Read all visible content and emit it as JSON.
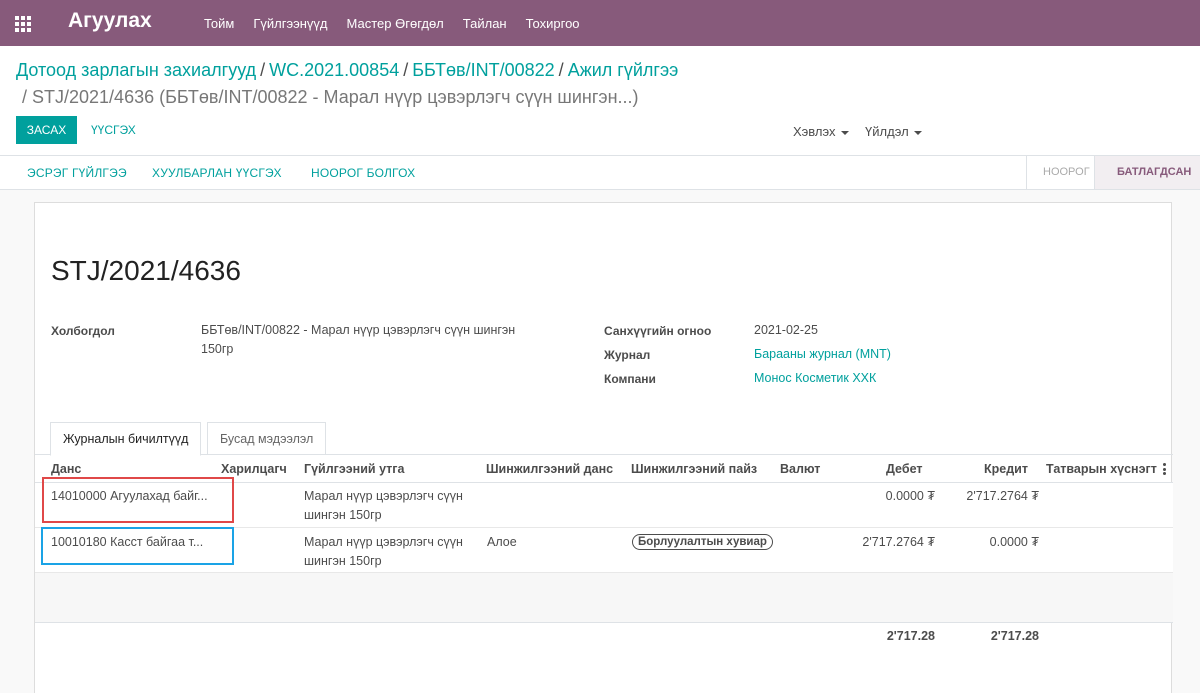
{
  "navbar": {
    "brand": "Агуулах",
    "menu": [
      "Тойм",
      "Гүйлгээнүүд",
      "Мастер Өгөгдөл",
      "Тайлан",
      "Тохиргоо"
    ]
  },
  "breadcrumb": {
    "items": [
      "Дотоод зарлагын захиалгууд",
      "WC.2021.00854",
      "ББТөв/INT/00822",
      "Ажил гүйлгээ"
    ],
    "current": "STJ/2021/4636 (ББТөв/INT/00822 - Марал нүүр цэвэрлэгч сүүн шингэн...)"
  },
  "buttons": {
    "edit": "ЗАСАХ",
    "create": "ҮҮСГЭХ"
  },
  "dropdowns": {
    "print": "Хэвлэх",
    "action": "Үйлдэл"
  },
  "statusbar": {
    "buttons": [
      "ЭСРЭГ ГҮЙЛГЭЭ",
      "ХУУЛБАРЛАН ҮҮСГЭХ",
      "НООРОГ БОЛГОХ"
    ],
    "stages": {
      "draft": "НООРОГ",
      "done": "БАТЛАГДСАН"
    }
  },
  "record": {
    "title": "STJ/2021/4636",
    "reference_label": "Холбогдол",
    "reference_value": "ББТөв/INT/00822 - Марал нүүр цэвэрлэгч сүүн шингэн 150гр",
    "date_label": "Санхүүгийн огноо",
    "date_value": "2021-02-25",
    "journal_label": "Журнал",
    "journal_value": "Барааны журнал (MNT)",
    "company_label": "Компани",
    "company_value": "Монос Косметик ХХК"
  },
  "tabs": {
    "active": "Журналын бичилтүүд",
    "other": "Бусад мэдээлэл"
  },
  "table": {
    "headers": [
      "Данс",
      "Харилцагч",
      "Гүйлгээний утга",
      "Шинжилгээний данс",
      "Шинжилгээний пайз",
      "Валют",
      "Дебет",
      "Кредит",
      "Татварын хүснэгт"
    ],
    "rows": [
      {
        "account": "14010000 Агуулахад байг...",
        "partner": "",
        "label": "Марал нүүр цэвэрлэгч сүүн шингэн 150гр",
        "analytic_account": "",
        "analytic_tag": "",
        "currency": "",
        "debit": "0.0000 ₮",
        "credit": "2'717.2764 ₮"
      },
      {
        "account": "10010180 Касст байгаа т...",
        "partner": "",
        "label": "Марал нүүр цэвэрлэгч сүүн шингэн 150гр",
        "analytic_account": "Алое",
        "analytic_tag": "Борлуулалтын хувиар",
        "currency": "",
        "debit": "2'717.2764 ₮",
        "credit": "0.0000 ₮"
      }
    ],
    "total_debit": "2'717.28",
    "total_credit": "2'717.28"
  }
}
